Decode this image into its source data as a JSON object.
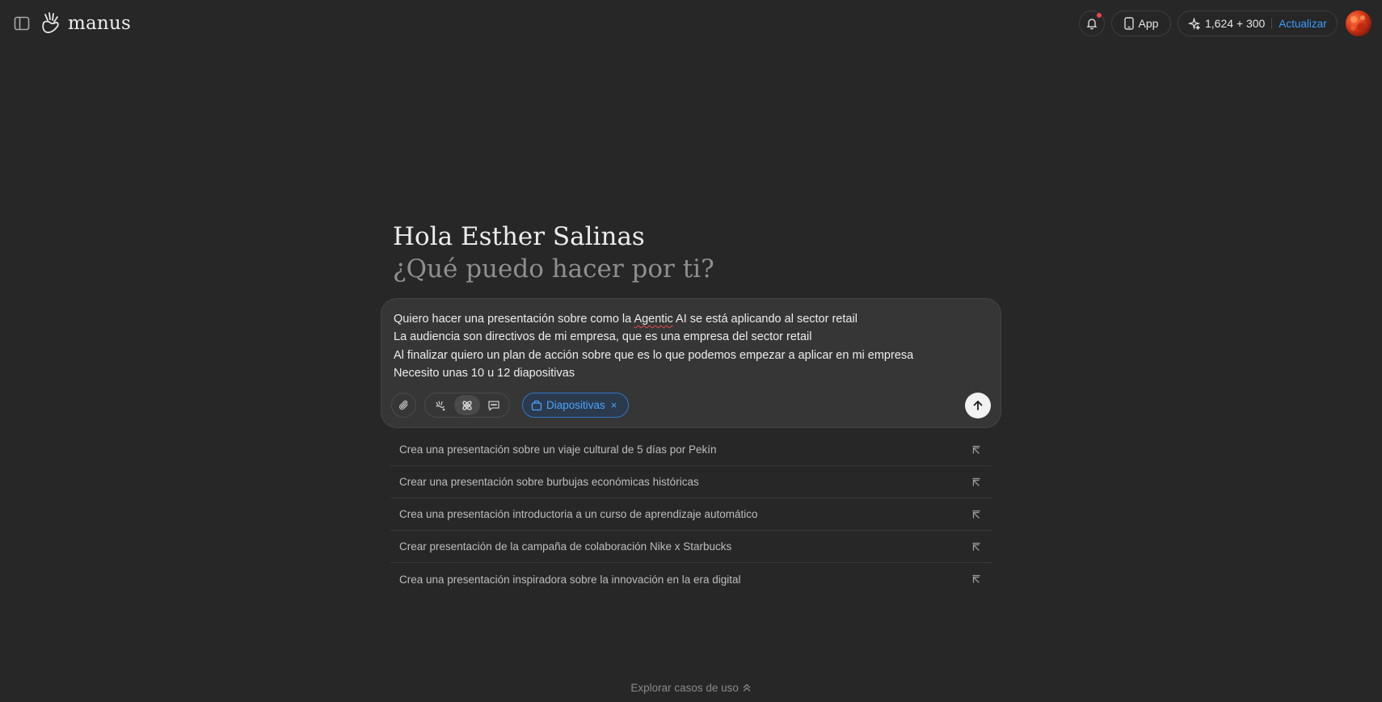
{
  "header": {
    "brand_name": "manus",
    "app_label": "App",
    "credits": "1,624 + 300",
    "upgrade_label": "Actualizar",
    "icons": {
      "sidebar": "sidebar-toggle-icon",
      "bell": "bell-icon",
      "phone": "phone-icon",
      "sparkle": "sparkle-icon"
    }
  },
  "greeting": {
    "title": "Hola Esther Salinas",
    "subtitle": "¿Qué puedo hacer por ti?"
  },
  "composer": {
    "line1_a": "Quiero hacer una presentación sobre como la ",
    "line1_b": "Agentic",
    "line1_c": " AI se está aplicando al sector retail",
    "line2": "La audiencia son directivos de mi empresa, que es una empresa del sector retail",
    "line3": "Al finalizar quiero un plan de acción sobre que es lo que podemos empezar a aplicar en mi empresa",
    "line4": "Necesito unas 10 u 12 diapositivas",
    "chip_label": "Diapositivas",
    "chip_close": "×"
  },
  "suggestions": [
    {
      "label": "Crea una presentación sobre un viaje cultural de 5 días por Pekín"
    },
    {
      "label": "Crear una presentación sobre burbujas económicas históricas"
    },
    {
      "label": "Crea una presentación introductoria a un curso de aprendizaje automático"
    },
    {
      "label": "Crear presentación de la campaña de colaboración Nike x Starbucks"
    },
    {
      "label": "Crea una presentación inspiradora sobre la innovación en la era digital"
    }
  ],
  "footer": {
    "explore_label": "Explorar casos de uso"
  },
  "colors": {
    "background": "#272727",
    "accent": "#3b9bff",
    "notification_dot": "#e5484d"
  }
}
